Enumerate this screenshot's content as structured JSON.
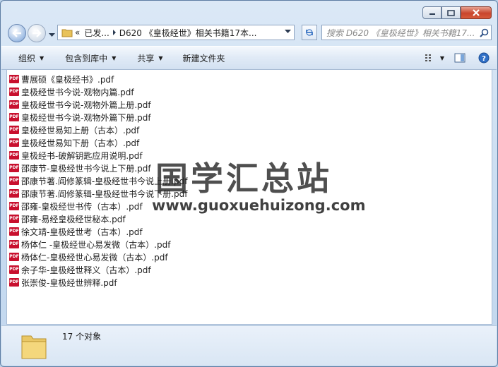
{
  "address": {
    "recent_marker": "«",
    "seg1": "已发...",
    "seg2": "D620 《皇极经世》相关书籍17本..."
  },
  "search": {
    "placeholder": "搜索 D620 《皇极经世》相关书籍17..."
  },
  "toolbar": {
    "organize": "组织",
    "include_library": "包含到库中",
    "share": "共享",
    "new_folder": "新建文件夹"
  },
  "files": [
    "曹展硕《皇极经书》.pdf",
    "皇极经世书今说-观物内篇.pdf",
    "皇极经世书今说-观物外篇上册.pdf",
    "皇极经世书今说-观物外篇下册.pdf",
    "皇极经世易知上册（古本）.pdf",
    "皇极经世易知下册（古本）.pdf",
    "皇极经书-破解钥匙应用说明.pdf",
    "邵康节-皇极经世书今说上下册.pdf",
    "邵康节著.阎修篆辑-皇极经世书今说上册.pdf",
    "邵康节著.阎修篆辑-皇极经世书今说下册.pdf",
    "邵雍-皇极经世书传（古本）.pdf",
    "邵雍-易经皇极经世秘本.pdf",
    "徐文靖-皇极经世考（古本）.pdf",
    "杨体仁 -皇极经世心易发微（古本）.pdf",
    "杨体仁-皇极经世心易发微（古本）.pdf",
    "余子华-皇极经世释义（古本）.pdf",
    "张崇俊-皇极经世辨释.pdf"
  ],
  "file_icon_text": "PDF",
  "watermark": {
    "title": "国学汇总站",
    "url": "www.guoxuehuizong.com"
  },
  "status": {
    "count": "17 个对象"
  }
}
